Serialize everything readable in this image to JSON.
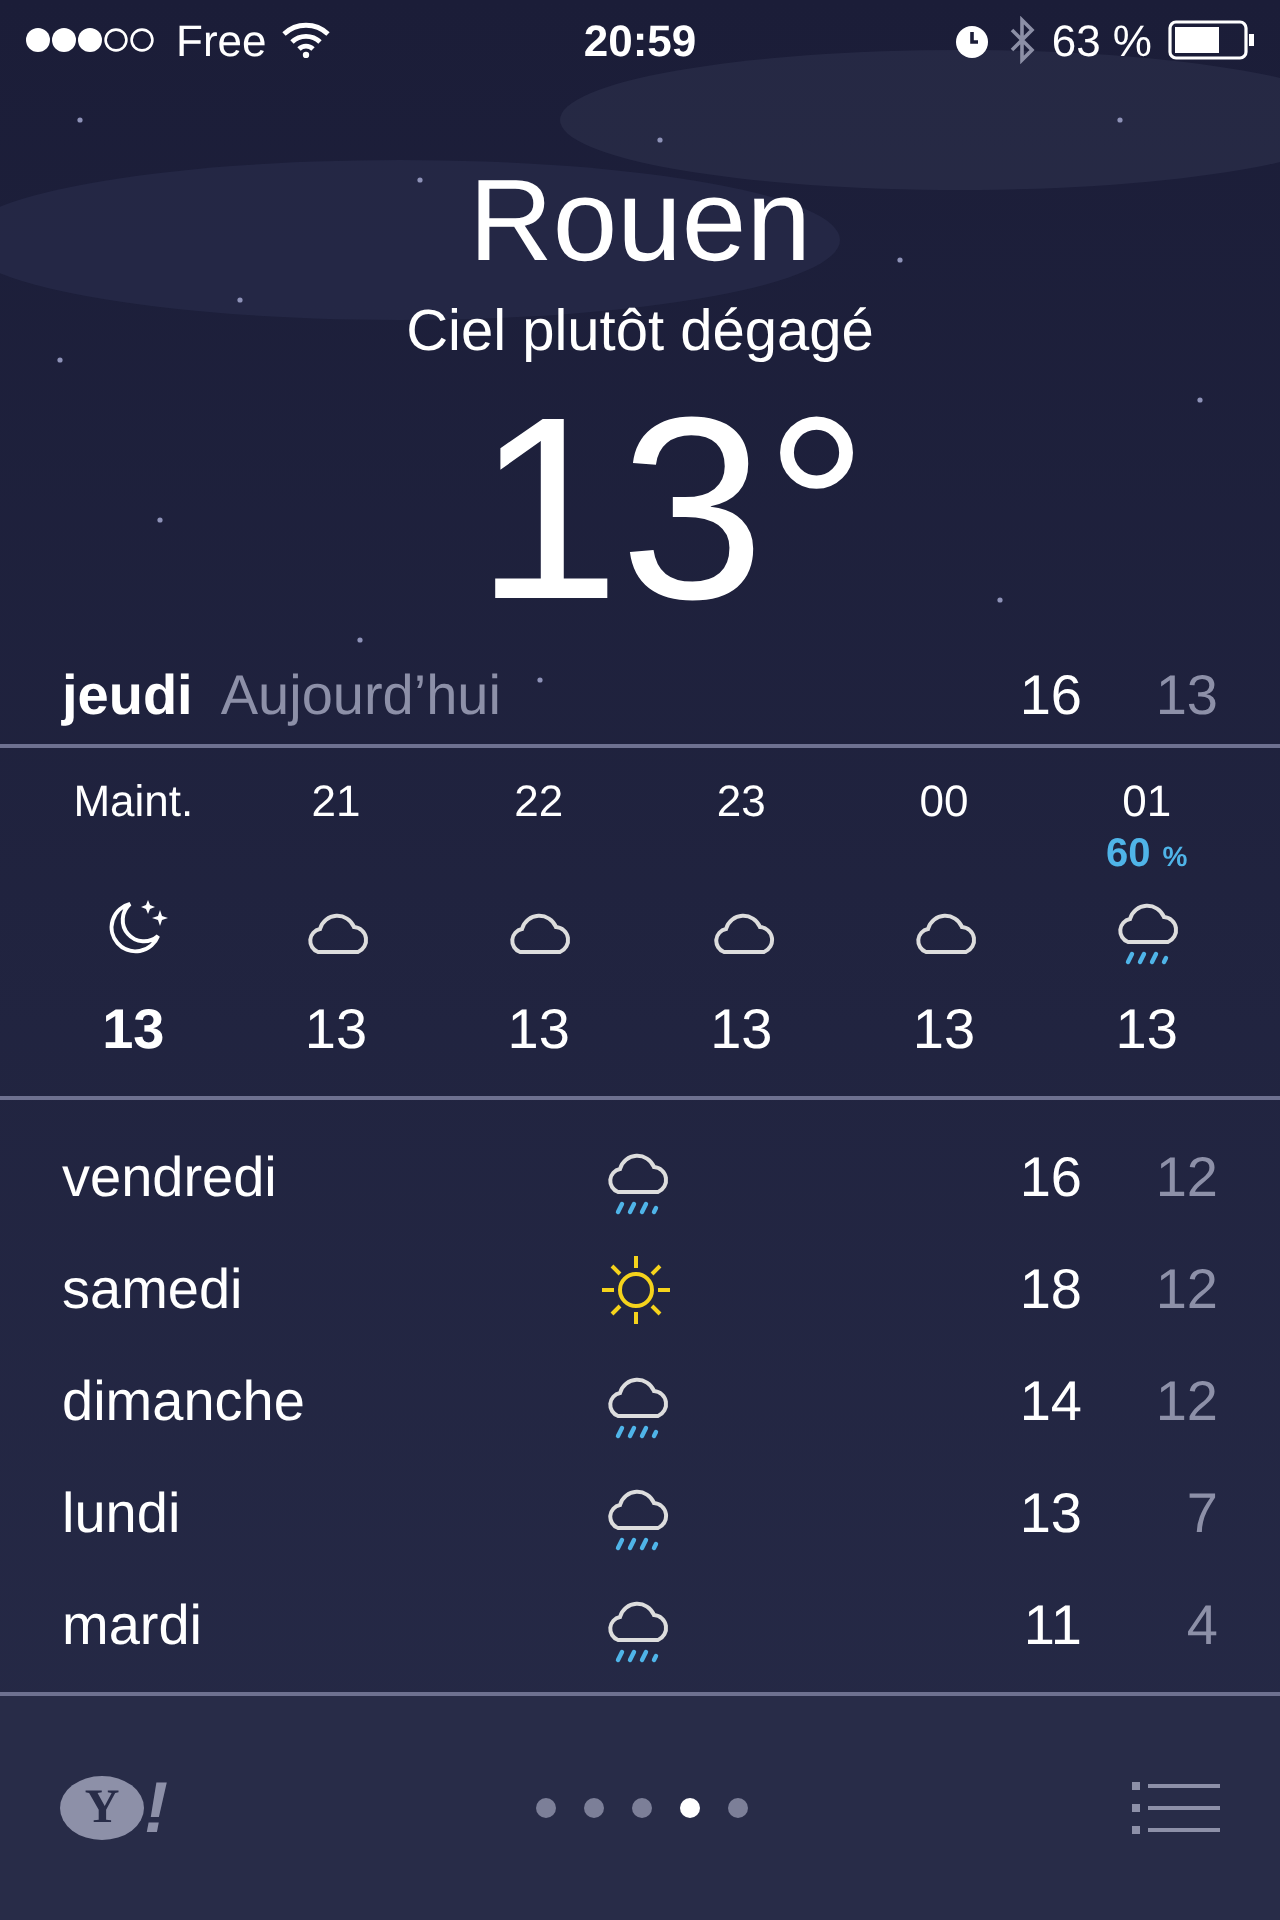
{
  "status_bar": {
    "carrier": "Free",
    "time": "20:59",
    "battery": "63 %"
  },
  "city": "Rouen",
  "condition": "Ciel plutôt dégagé",
  "temperature": "13°",
  "today": {
    "day": "jeudi",
    "label": "Aujourd’hui",
    "high": "16",
    "low": "13"
  },
  "hourly": [
    {
      "time": "Maint.",
      "kind": "moon",
      "temp": "13",
      "current": true
    },
    {
      "time": "21",
      "kind": "cloud",
      "temp": "13",
      "current": false
    },
    {
      "time": "22",
      "kind": "cloud",
      "temp": "13",
      "current": false
    },
    {
      "time": "23",
      "kind": "cloud",
      "temp": "13",
      "current": false
    },
    {
      "time": "00",
      "kind": "cloud",
      "temp": "13",
      "current": false
    },
    {
      "time": "01",
      "kind": "rain",
      "temp": "13",
      "current": false,
      "precip": "60",
      "precip_unit": "%"
    }
  ],
  "daily": [
    {
      "day": "vendredi",
      "kind": "rain",
      "high": "16",
      "low": "12"
    },
    {
      "day": "samedi",
      "kind": "sun",
      "high": "18",
      "low": "12"
    },
    {
      "day": "dimanche",
      "kind": "rain",
      "high": "14",
      "low": "12"
    },
    {
      "day": "lundi",
      "kind": "rain",
      "high": "13",
      "low": "7"
    },
    {
      "day": "mardi",
      "kind": "rain",
      "high": "11",
      "low": "4"
    }
  ],
  "footer": {
    "logo_letter": "Y",
    "logo_mark": "!",
    "pages": [
      {
        "selected": false
      },
      {
        "selected": false
      },
      {
        "selected": false
      },
      {
        "selected": true
      },
      {
        "selected": false
      }
    ]
  }
}
